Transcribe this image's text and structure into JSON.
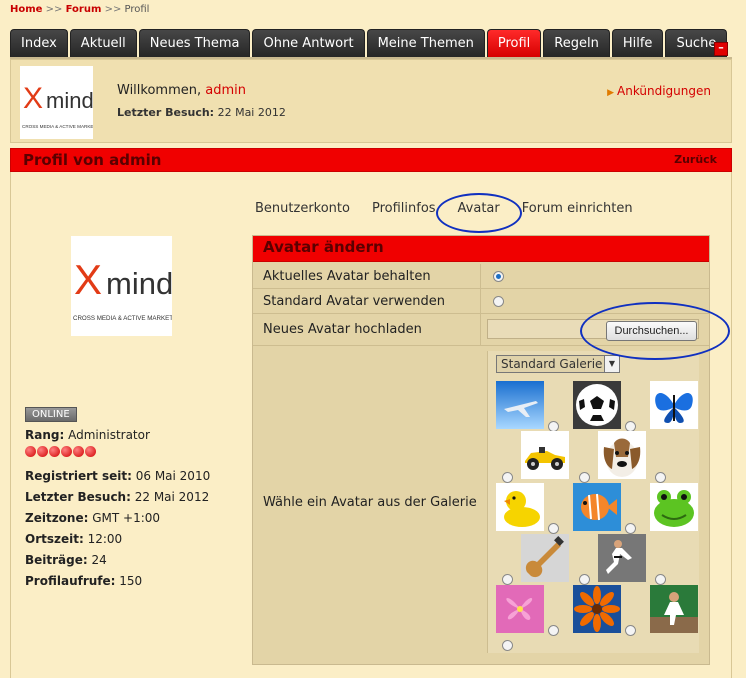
{
  "breadcrumb": {
    "home": "Home",
    "sep1": ">>",
    "forum": "Forum",
    "sep2": ">>",
    "current": "Profil"
  },
  "tabs": [
    {
      "label": "Index"
    },
    {
      "label": "Aktuell"
    },
    {
      "label": "Neues Thema"
    },
    {
      "label": "Ohne Antwort"
    },
    {
      "label": "Meine Themen"
    },
    {
      "label": "Profil",
      "active": true
    },
    {
      "label": "Regeln"
    },
    {
      "label": "Hilfe"
    },
    {
      "label": "Suche"
    }
  ],
  "minimize_symbol": "–",
  "logo": {
    "brand": "X mind",
    "tagline": "CROSS MEDIA & ACTIVE MARKETING"
  },
  "welcome": {
    "greeting": "Willkommen,",
    "username": "admin",
    "last_visit_label": "Letzter Besuch:",
    "last_visit_value": "22 Mai 2012",
    "announcements": "Ankündigungen"
  },
  "profile_header": {
    "title": "Profil von admin",
    "back": "Zurück"
  },
  "subtabs": [
    {
      "label": "Benutzerkonto"
    },
    {
      "label": "Profilinfos"
    },
    {
      "label": "Avatar"
    },
    {
      "label": "Forum einrichten"
    }
  ],
  "sidebar": {
    "status": "ONLINE",
    "rank_label": "Rang:",
    "rank_value": "Administrator",
    "rank_stars": 6,
    "stats": [
      {
        "label": "Registriert seit:",
        "value": "06 Mai 2010"
      },
      {
        "label": "Letzter Besuch:",
        "value": "22 Mai 2012"
      },
      {
        "label": "Zeitzone:",
        "value": "GMT +1:00"
      },
      {
        "label": "Ortszeit:",
        "value": "12:00"
      },
      {
        "label": "Beiträge:",
        "value": "24"
      },
      {
        "label": "Profilaufrufe:",
        "value": "150"
      }
    ]
  },
  "avatar_form": {
    "title": "Avatar ändern",
    "keep_label": "Aktuelles Avatar behalten",
    "standard_label": "Standard Avatar verwenden",
    "upload_label": "Neues Avatar hochladen",
    "browse_button": "Durchsuchen...",
    "gallery_label": "Wähle ein Avatar aus der Galerie",
    "gallery_select": "Standard Galerie",
    "gallery_items": [
      "airplane",
      "soccer-ball",
      "butterfly",
      "race-car",
      "dog",
      "rubber-duck",
      "fish",
      "frog",
      "bass-guitar",
      "karate",
      "pink-flower",
      "orange-flower",
      "stage-performer"
    ],
    "selected_option": "keep"
  },
  "colors": {
    "accent_red": "#f00000",
    "background": "#fbeec6",
    "panel": "#e3d4a7",
    "annotation_blue": "#1030c0"
  }
}
